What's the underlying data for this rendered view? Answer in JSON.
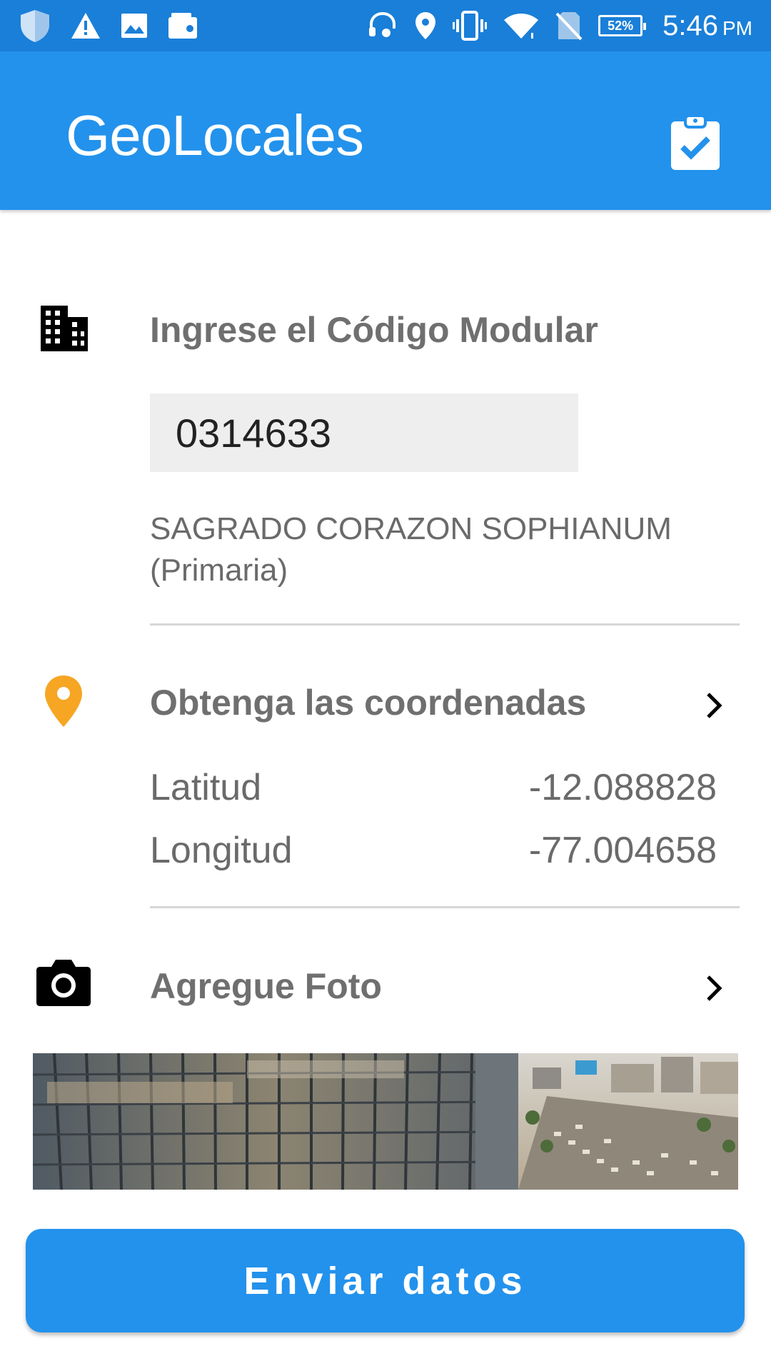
{
  "status_bar": {
    "battery_percent": "52%",
    "time": "5:46",
    "ampm": "PM",
    "icons_left": [
      "shield-icon",
      "warning-icon",
      "image-icon",
      "wallet-icon"
    ],
    "icons_right": [
      "headset-icon",
      "location-icon",
      "vibrate-icon",
      "wifi-icon",
      "no-sim-icon",
      "battery-icon"
    ]
  },
  "app_bar": {
    "title": "GeoLocales",
    "action_icon": "clipboard-check-icon"
  },
  "code_section": {
    "title": "Ingrese el Código Modular",
    "icon": "building-icon",
    "input_value": "0314633",
    "school_name": "SAGRADO CORAZON SOPHIANUM (Primaria)"
  },
  "coords_section": {
    "title": "Obtenga las coordenadas",
    "icon": "location-pin-icon",
    "latitude_label": "Latitud",
    "latitude_value": "-12.088828",
    "longitude_label": "Longitud",
    "longitude_value": "-77.004658"
  },
  "photo_section": {
    "title": "Agregue Foto",
    "icon": "camera-icon"
  },
  "send_button": {
    "label": "Enviar datos"
  },
  "colors": {
    "status_bar": "#1a7fd8",
    "app_bar": "#2392ec",
    "accent": "#2392ec",
    "pin": "#f6a623",
    "section_title": "#6f6f6f"
  }
}
